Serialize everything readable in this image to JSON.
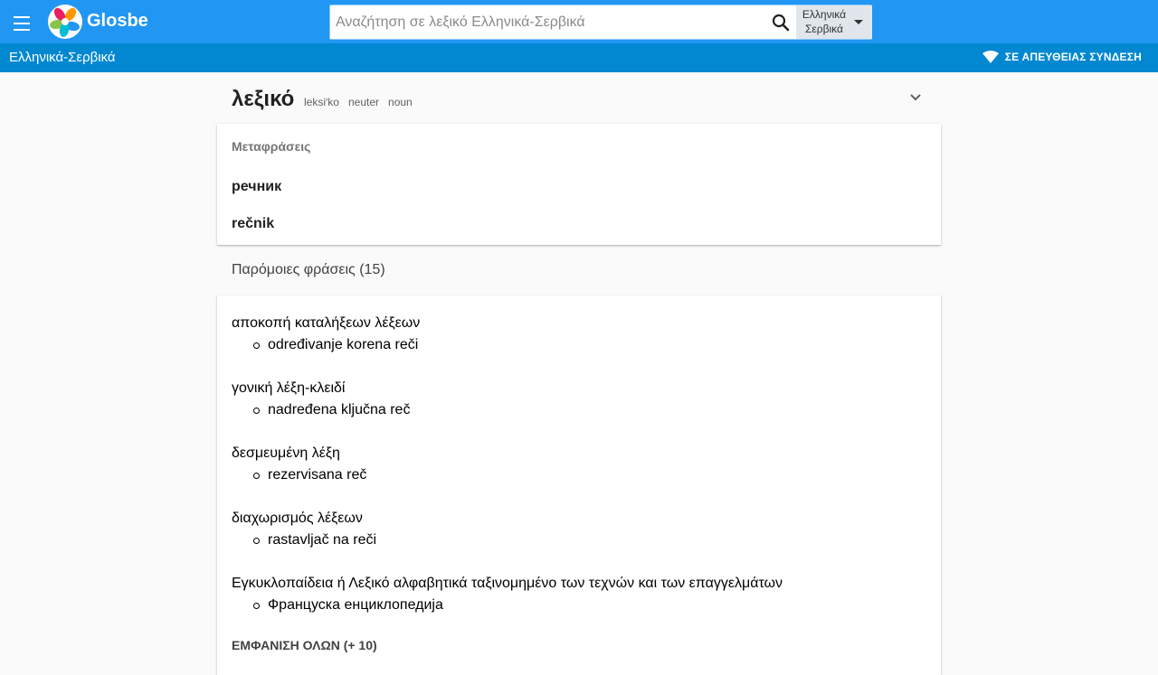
{
  "header": {
    "brand": "Glosbe",
    "search": {
      "placeholder": "Αναζήτηση σε λεξικό Ελληνικά-Σερβικά",
      "value": ""
    },
    "language_select": {
      "line1": "Ελληνικά",
      "line2": "Σερβικά"
    }
  },
  "subbar": {
    "title": "Ελληνικά-Σερβικά",
    "online_label": "ΣΕ ΑΠΕΥΘΕΙΑΣ ΣΥΝΔΕΣΗ"
  },
  "entry": {
    "headword": "λεξικό",
    "pronunciation": "leksiʹko",
    "gender": "neuter",
    "pos": "noun"
  },
  "translations": {
    "title": "Μεταφράσεις",
    "items": [
      "речник",
      "rečnik"
    ]
  },
  "similar": {
    "title": "Παρόμοιες φράσεις (15)",
    "phrases": [
      {
        "source": "αποκοπή καταλήξεων λέξεων",
        "translation": "određivanje korena reči"
      },
      {
        "source": "γονική λέξη-κλειδί",
        "translation": "nadređena ključna reč"
      },
      {
        "source": "δεσμευμένη λέξη",
        "translation": "rezervisana reč"
      },
      {
        "source": "διαχωρισμός λέξεων",
        "translation": "rastavljač na reči"
      },
      {
        "source": "Εγκυκλοπαίδεια ή Λεξικό αλφαβητικά ταξινομημένο των τεχνών και των επαγγελμάτων",
        "translation": "Француска енциклопедија"
      }
    ],
    "show_all": "ΕΜΦΑΝΙΣΗ ΟΛΩΝ (+ 10)"
  },
  "colors": {
    "topbar": "#2196f3",
    "subbar": "#0288d1"
  },
  "icons": [
    "menu-icon",
    "glosbe-logo",
    "search-icon",
    "caret-down-icon",
    "wifi-icon",
    "chevron-down-icon"
  ]
}
